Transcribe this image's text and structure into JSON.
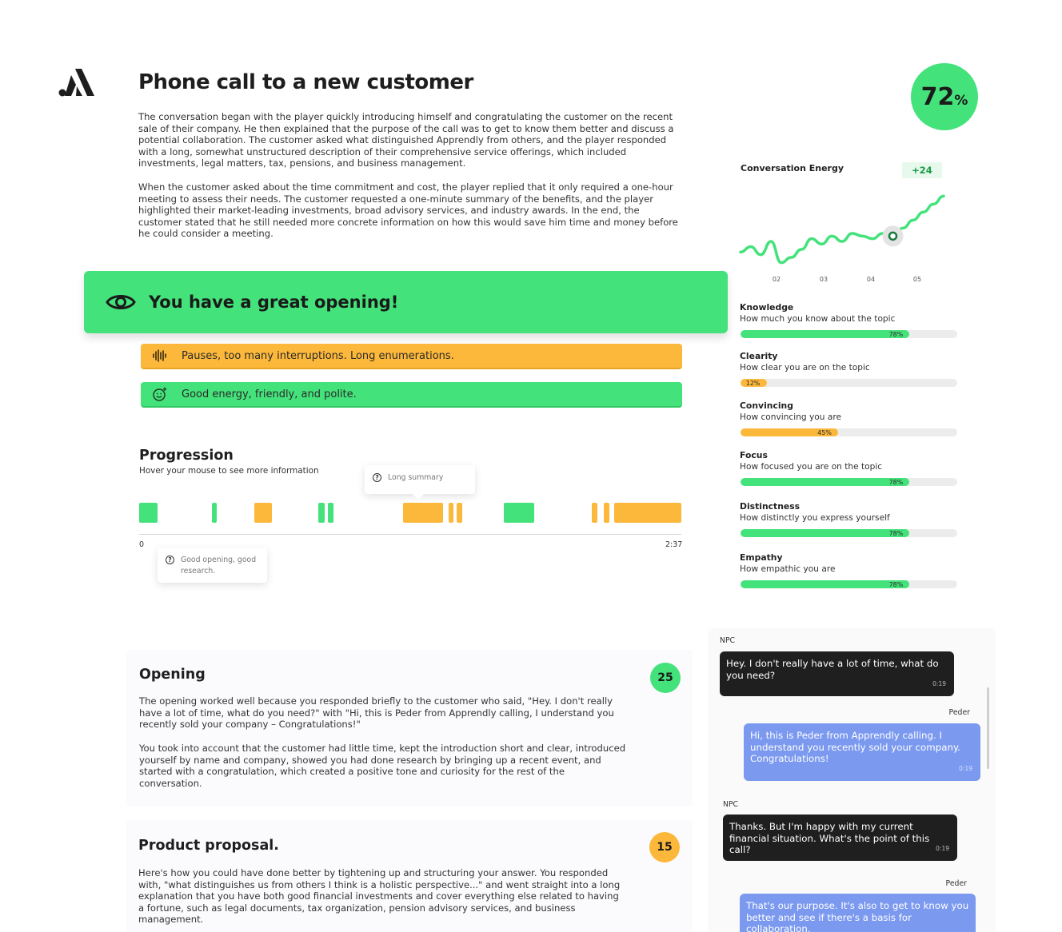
{
  "header": {
    "title": "Phone call to a new customer",
    "summary": [
      "The conversation began with the player quickly introducing himself and congratulating the customer on the recent sale of their company. He then explained that the purpose of the call was to get to know them better and discuss a potential collaboration. The customer asked what distinguished Apprendly from others, and the player responded with a long, somewhat unstructured description of their comprehensive service offerings, which included investments, legal matters, tax, pensions, and business management.",
      "When the customer asked about the time commitment and cost, the player replied that it only required a one-hour meeting to assess their needs. The customer requested a one-minute summary of the benefits, and the player highlighted their market-leading investments, broad advisory services, and industry awards. In the end, the customer stated that he still needed more concrete information on how this would save him time and money before he could consider a meeting."
    ]
  },
  "score": {
    "value": "72",
    "unit": "%"
  },
  "energy": {
    "title": "Conversation Energy",
    "delta": "+24",
    "ticks": [
      "02",
      "03",
      "04",
      "05"
    ]
  },
  "chart_data": {
    "type": "line",
    "title": "Conversation Energy",
    "x_ticks": [
      "02",
      "03",
      "04",
      "05"
    ],
    "annotation": "+24",
    "series": [
      {
        "values": [
          10,
          14,
          8,
          18,
          2,
          6,
          12,
          20,
          16,
          22,
          18,
          24,
          22,
          20,
          24,
          22,
          28,
          34,
          40,
          46,
          52
        ]
      }
    ],
    "ylim": [
      0,
      60
    ],
    "grid": false
  },
  "banner": {
    "title": "You have a great opening!",
    "warning": "Pauses, too many interruptions. Long enumerations.",
    "positive": "Good energy, friendly, and polite."
  },
  "progression": {
    "title": "Progression",
    "subtitle": "Hover your mouse to see more information",
    "start": "0",
    "end": "2:37",
    "tip_long": "Long summary",
    "tip_open": "Good opening, good research.",
    "segments": [
      {
        "start": 0,
        "end": 3.4,
        "kind": "good"
      },
      {
        "start": 13.4,
        "end": 14.3,
        "kind": "good"
      },
      {
        "start": 21.2,
        "end": 24.5,
        "kind": "warn"
      },
      {
        "start": 33.0,
        "end": 34.2,
        "kind": "good"
      },
      {
        "start": 34.8,
        "end": 35.9,
        "kind": "good"
      },
      {
        "start": 48.6,
        "end": 56.1,
        "kind": "warn"
      },
      {
        "start": 57.1,
        "end": 58.0,
        "kind": "warn"
      },
      {
        "start": 58.6,
        "end": 59.6,
        "kind": "warn"
      },
      {
        "start": 67.3,
        "end": 72.8,
        "kind": "good"
      },
      {
        "start": 83.5,
        "end": 84.5,
        "kind": "warn"
      },
      {
        "start": 85.7,
        "end": 86.8,
        "kind": "warn"
      },
      {
        "start": 87.6,
        "end": 100,
        "kind": "warn"
      }
    ]
  },
  "metrics": [
    {
      "title": "Knowledge",
      "desc": "How much you know about the topic",
      "value": 78,
      "label": "78%",
      "color": "#44e27a"
    },
    {
      "title": "Clearity",
      "desc": "How clear you are on the topic",
      "value": 12,
      "label": "12%",
      "color": "#fcb83a"
    },
    {
      "title": "Convincing",
      "desc": "How convincing you are",
      "value": 45,
      "label": "45%",
      "color": "#fcb83a"
    },
    {
      "title": "Focus",
      "desc": "How focused you are on the topic",
      "value": 78,
      "label": "78%",
      "color": "#44e27a"
    },
    {
      "title": "Distinctness",
      "desc": "How distinctly you express yourself",
      "value": 78,
      "label": "78%",
      "color": "#44e27a"
    },
    {
      "title": "Empathy",
      "desc": "How empathic you are",
      "value": 78,
      "label": "78%",
      "color": "#44e27a"
    }
  ],
  "cards": {
    "opening": {
      "title": "Opening",
      "score": "25",
      "p1": "The opening worked well because you responded briefly to the customer who said, \"Hey. I don't really have a lot of time, what do you need?\" with \"Hi, this is Peder from Apprendly calling, I understand you recently sold your company – Congratulations!\"",
      "p2": "You took into account that the customer had little time, kept the introduction short and clear, introduced yourself by name and company, showed you had done research by bringing up a recent event, and started with a congratulation, which created a positive tone and curiosity for the rest of the conversation."
    },
    "product": {
      "title": "Product proposal.",
      "score": "15",
      "p1": "Here's how you could have done better by tightening up and structuring your answer. You responded with, \"what distinguishes us from others I think is a holistic perspective...\" and went straight into a long explanation that you have both good financial investments and cover everything else related to having a fortune, such as legal documents, tax organization, pension advisory services, and business management."
    }
  },
  "chat": [
    {
      "who": "NPC",
      "text": "Hey. I don't really have a lot of time, what do you need?",
      "time": "0:19"
    },
    {
      "who": "Peder",
      "text": "Hi, this is Peder from Apprendly calling. I understand you recently sold your company. Congratulations!",
      "time": "0:19"
    },
    {
      "who": "NPC",
      "text": "Thanks. But I'm happy with my current financial situation. What's the point of this call?",
      "time": "0:19"
    },
    {
      "who": "Peder",
      "text": "That's our purpose. It's also to get to know you better and see if there's a basis for collaboration.",
      "time": ""
    }
  ],
  "colors": {
    "green": "#44e27a",
    "orange": "#fcb83a",
    "blue": "#7b99ef",
    "dark": "#1f1f1f"
  }
}
